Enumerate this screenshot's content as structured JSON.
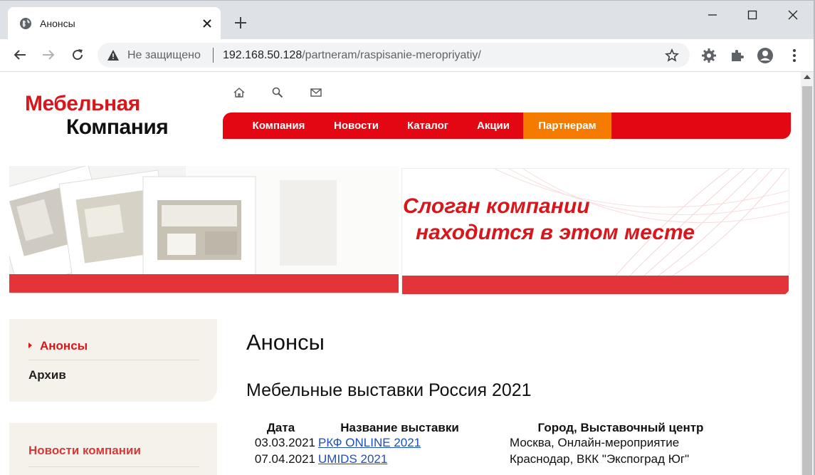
{
  "browser": {
    "tab_title": "Анонсы",
    "omnibox": {
      "security_label": "Не защищено",
      "url_host": "192.168.50.128",
      "url_path": "/partneram/raspisanie-meropriyatiy/"
    }
  },
  "site": {
    "logo": {
      "line1": "Мебельная",
      "line2": "Компания"
    },
    "top_icons": [
      "home-icon",
      "search-icon",
      "mail-icon"
    ],
    "nav": [
      {
        "label": "Компания",
        "active": false
      },
      {
        "label": "Новости",
        "active": false
      },
      {
        "label": "Каталог",
        "active": false
      },
      {
        "label": "Акции",
        "active": false
      },
      {
        "label": "Партнерам",
        "active": true
      }
    ],
    "banner": {
      "slogan_line1": "Слоган компании",
      "slogan_line2": "находится в этом месте"
    },
    "colors": {
      "brand_red": "#e30613",
      "active_orange": "#f47a00",
      "sidebar_bg": "#f4f2ea",
      "link_blue": "#1f4fbd"
    }
  },
  "sidebar": {
    "menu": [
      {
        "label": "Анонсы",
        "active": true
      },
      {
        "label": "Архив",
        "active": false
      }
    ],
    "news_heading": "Новости компании"
  },
  "content": {
    "title": "Анонсы",
    "subtitle": "Мебельные выставки Россия 2021",
    "table": {
      "headers": [
        "Дата",
        "Название выставки",
        "Город, Выставочный центр"
      ],
      "rows": [
        {
          "date": "03.03.2021",
          "name": "РКФ ONLINE 2021",
          "city": "Москва, Онлайн-мероприятие"
        },
        {
          "date": "07.04.2021",
          "name": "UMIDS 2021",
          "city": "Краснодар, ВКК \"Экспоград Юг\""
        }
      ]
    }
  }
}
